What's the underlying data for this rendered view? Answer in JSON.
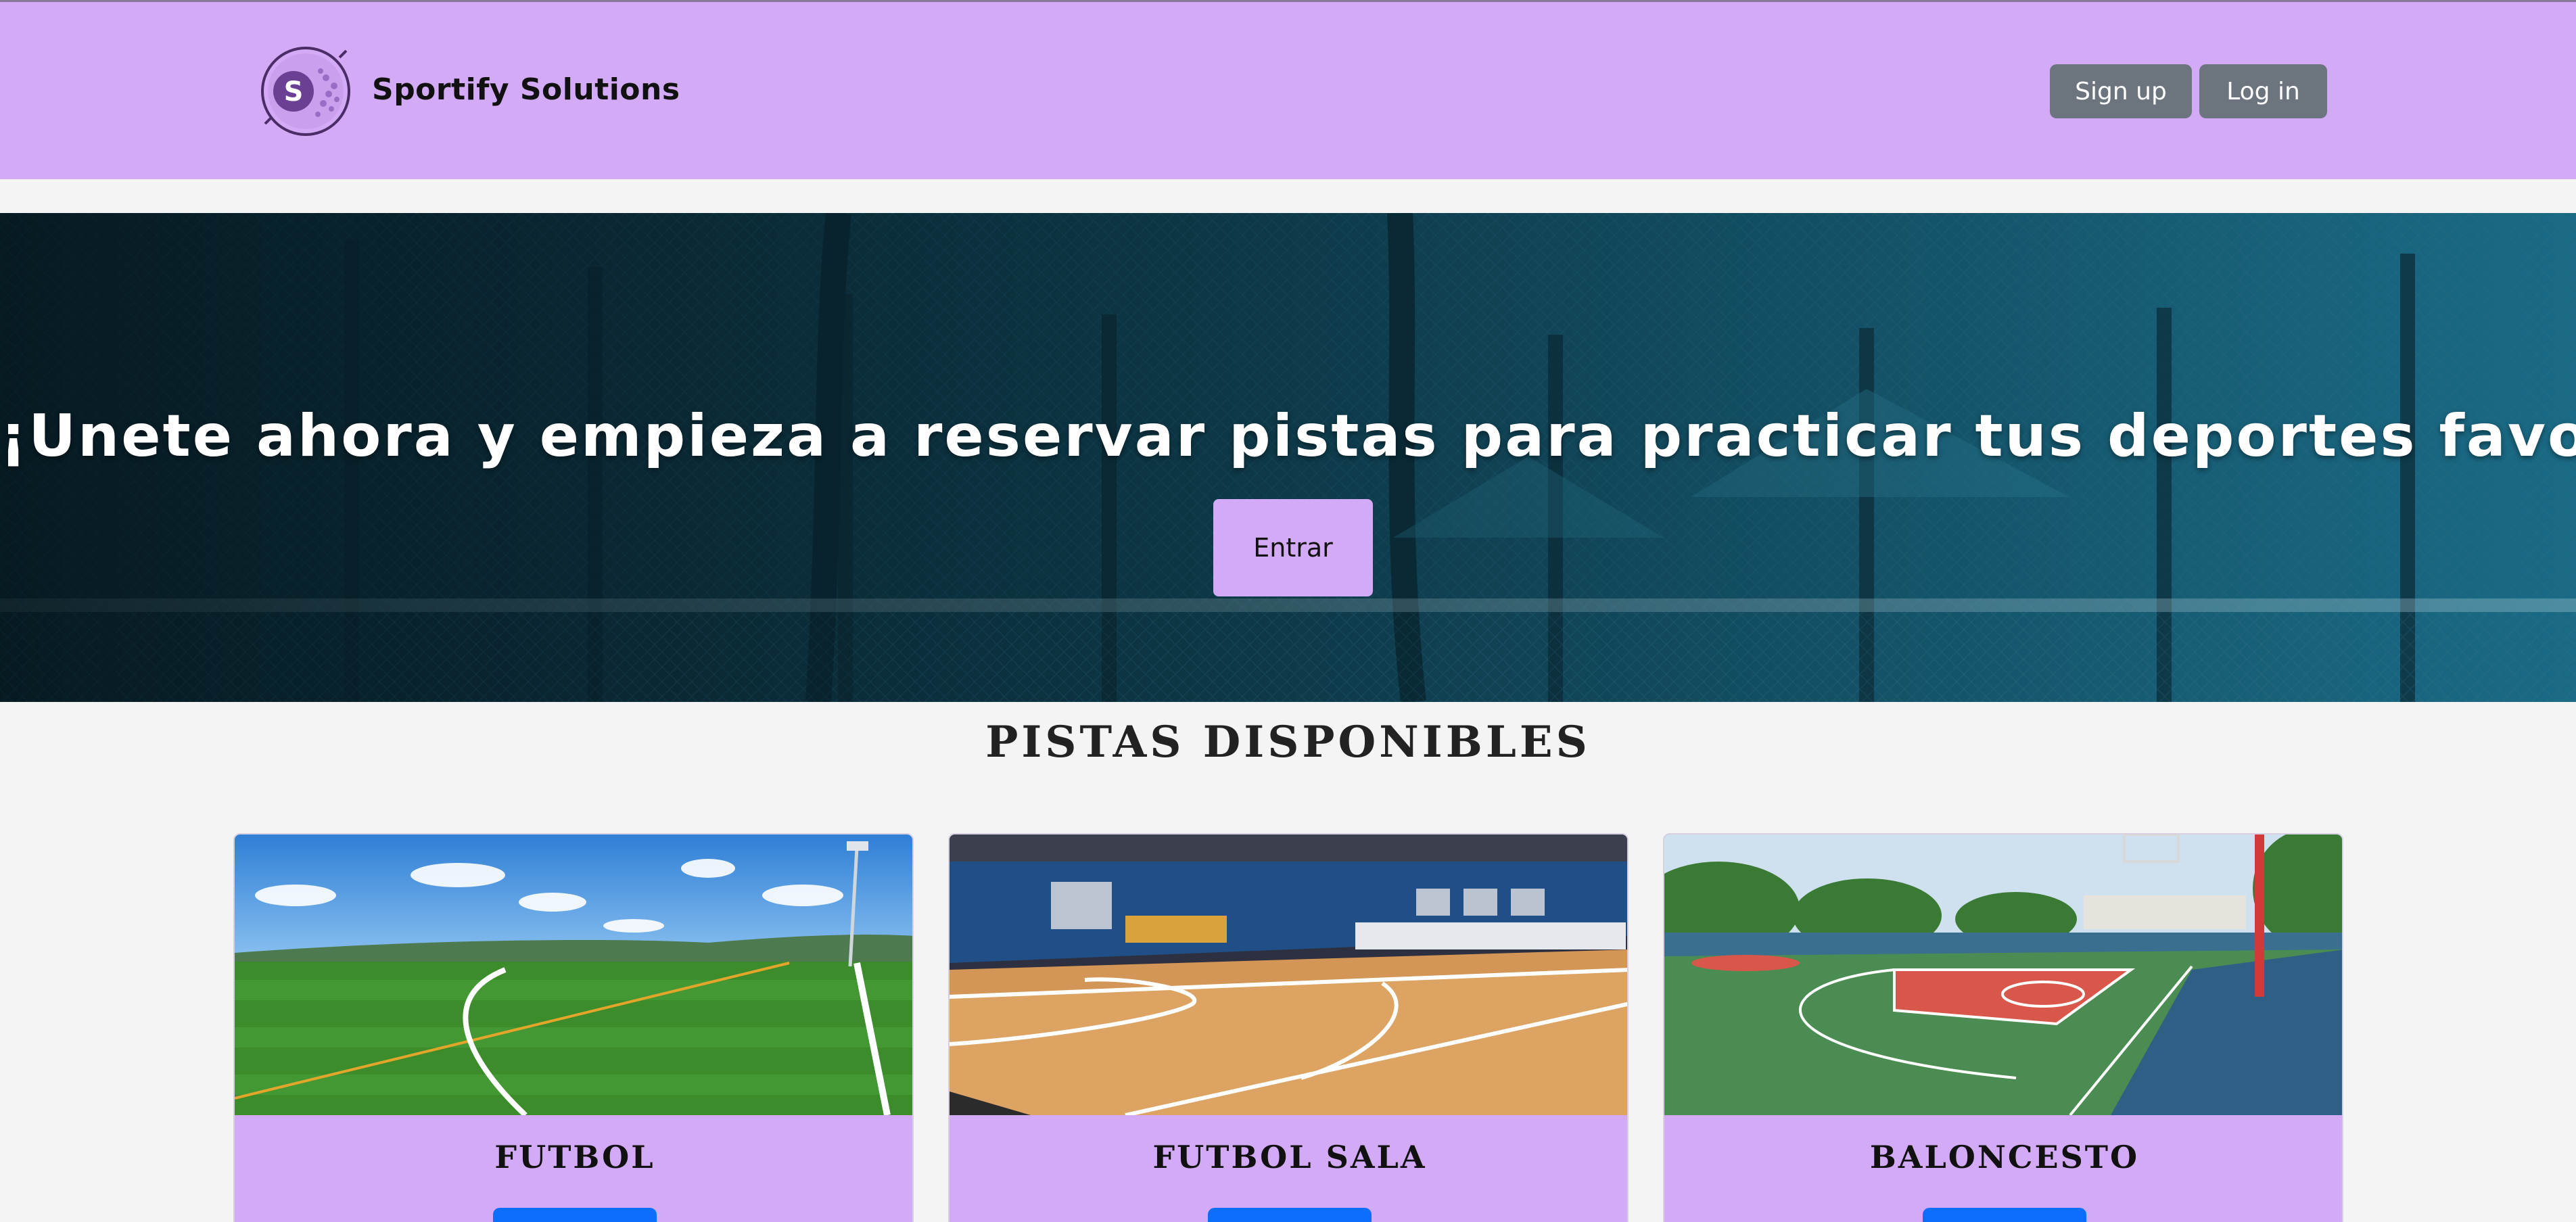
{
  "header": {
    "brand": "Sportify Solutions",
    "logo_letter": "S",
    "signup_label": "Sign up",
    "login_label": "Log in"
  },
  "hero": {
    "title": "¡Unete ahora y empieza a reservar pistas para practicar tus deportes favoritos!",
    "button_label": "Entrar"
  },
  "courts": {
    "title": "PISTAS DISPONIBLES",
    "items": [
      {
        "name": "FUTBOL"
      },
      {
        "name": "FUTBOL SALA"
      },
      {
        "name": "BALONCESTO"
      }
    ]
  },
  "colors": {
    "header_bg": "#d3aaf5",
    "accent_purple": "#d3aaf5",
    "grey_button": "#6c757d",
    "primary_button": "#0d6efd",
    "hero_overlay": "#14546a"
  }
}
